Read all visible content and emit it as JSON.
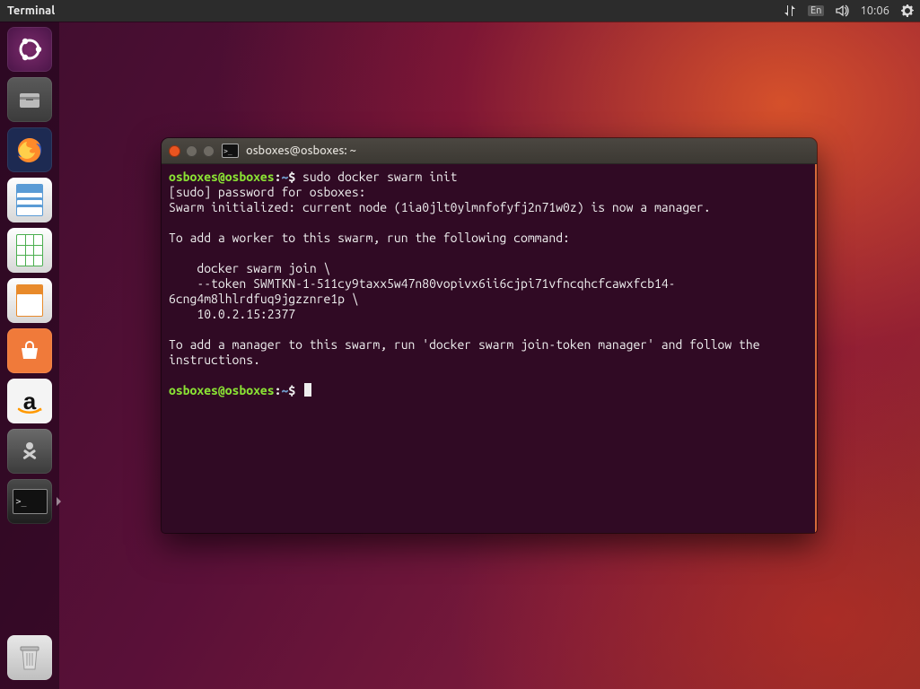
{
  "topbar": {
    "active_app": "Terminal",
    "lang": "En",
    "time": "10:06"
  },
  "launcher": {
    "items": [
      {
        "name": "ubuntu-dash",
        "icon": "◌"
      },
      {
        "name": "files",
        "icon": "🗄"
      },
      {
        "name": "firefox",
        "icon": "🦊"
      },
      {
        "name": "libreoffice-writer",
        "icon": ""
      },
      {
        "name": "libreoffice-calc",
        "icon": ""
      },
      {
        "name": "libreoffice-impress",
        "icon": ""
      },
      {
        "name": "ubuntu-software",
        "icon": "🛍"
      },
      {
        "name": "amazon",
        "icon": "a"
      },
      {
        "name": "system-settings",
        "icon": "🛠"
      },
      {
        "name": "terminal",
        "icon": ">_"
      },
      {
        "name": "trash",
        "icon": "🗑"
      }
    ]
  },
  "terminal": {
    "title": "osboxes@osboxes: ~",
    "prompt": {
      "user": "osboxes@osboxes",
      "path": "~",
      "sigil": "$"
    },
    "command1": "sudo docker swarm init",
    "lines": [
      "[sudo] password for osboxes:",
      "Swarm initialized: current node (1ia0jlt0ylmnfofyfj2n71w0z) is now a manager.",
      "",
      "To add a worker to this swarm, run the following command:",
      "",
      "    docker swarm join \\",
      "    --token SWMTKN-1-511cy9taxx5w47n80vopivx6ii6cjpi71vfncqhcfcawxfcb14-6cng4m8lhlrdfuq9jgzznre1p \\",
      "    10.0.2.15:2377",
      "",
      "To add a manager to this swarm, run 'docker swarm join-token manager' and follow the instructions.",
      ""
    ]
  }
}
